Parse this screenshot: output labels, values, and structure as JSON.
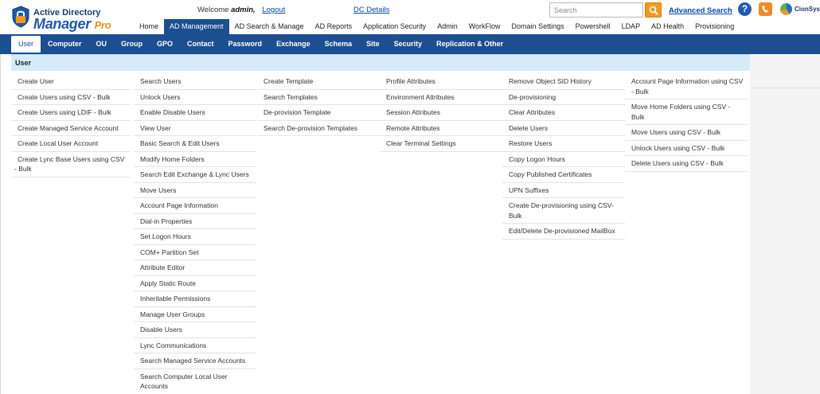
{
  "header": {
    "logo_line1": "Active Directory",
    "logo_line2": "Manager",
    "logo_pro": "Pro",
    "welcome_prefix": "Welcome",
    "user": "admin,",
    "logout": "Logout",
    "dc_details": "DC Details",
    "search_placeholder": "Search",
    "advanced_search": "Advanced Search",
    "help": "?",
    "company": "CionSys"
  },
  "topnav": [
    {
      "label": "Home",
      "active": false
    },
    {
      "label": "AD Management",
      "active": true
    },
    {
      "label": "AD Search & Manage",
      "active": false
    },
    {
      "label": "AD Reports",
      "active": false
    },
    {
      "label": "Application Security",
      "active": false
    },
    {
      "label": "Admin",
      "active": false
    },
    {
      "label": "WorkFlow",
      "active": false
    },
    {
      "label": "Domain Settings",
      "active": false
    },
    {
      "label": "Powershell",
      "active": false
    },
    {
      "label": "LDAP",
      "active": false
    },
    {
      "label": "AD Health",
      "active": false
    },
    {
      "label": "Provisioning",
      "active": false
    }
  ],
  "subnav": [
    {
      "label": "User",
      "active": true
    },
    {
      "label": "Computer",
      "active": false
    },
    {
      "label": "OU",
      "active": false
    },
    {
      "label": "Group",
      "active": false
    },
    {
      "label": "GPO",
      "active": false
    },
    {
      "label": "Contact",
      "active": false
    },
    {
      "label": "Password",
      "active": false
    },
    {
      "label": "Exchange",
      "active": false
    },
    {
      "label": "Schema",
      "active": false
    },
    {
      "label": "Site",
      "active": false
    },
    {
      "label": "Security",
      "active": false
    },
    {
      "label": "Replication & Other",
      "active": false
    }
  ],
  "menu": {
    "title": "User",
    "columns": [
      [
        "Create User",
        "Create Users using CSV - Bulk",
        "Create Users using LDIF - Bulk",
        "Create Managed Service Account",
        "Create Local User Account",
        "Create Lync Base Users using CSV - Bulk"
      ],
      [
        "Search Users",
        "Unlock Users",
        "Enable Disable Users",
        "View User",
        "Basic Search & Edit Users",
        "Modify Home Folders",
        "Search Edit Exchange & Lync Users",
        "Move Users",
        "Account Page Information",
        "Dial-in Properties",
        "Set Logon Hours",
        "COM+ Partition Set",
        "Attribute Editor",
        "Apply Static Route",
        "Inheritable Permissions",
        "Manage User Groups",
        "Disable Users",
        "Lync Communications",
        "Search Managed Service Accounts",
        "Search Computer Local User Accounts"
      ],
      [
        "Create Template",
        "Search Templates",
        "De-provision Template",
        "Search De-provision Templates"
      ],
      [
        "Profile Attributes",
        "Environment Attributes",
        "Session Attributes",
        "Remote Attributes",
        "Clear Terminal Settings"
      ],
      [
        "Remove Object SID History",
        "De-provisioning",
        "Clear Attributes",
        "Delete Users",
        "Restore Users",
        "Copy Logon Hours",
        "Copy Published Certificates",
        "UPN Suffixes",
        "Create De-provisioning using CSV-Bulk",
        "Edit/Delete De-provisioned MailBox"
      ],
      [
        "Account Page Information using CSV - Bulk",
        "Move Home Folders using CSV - Bulk",
        "Move Users using CSV - Bulk",
        "Unlock Users using CSV - Bulk",
        "Delete Users using CSV - Bulk"
      ]
    ]
  }
}
